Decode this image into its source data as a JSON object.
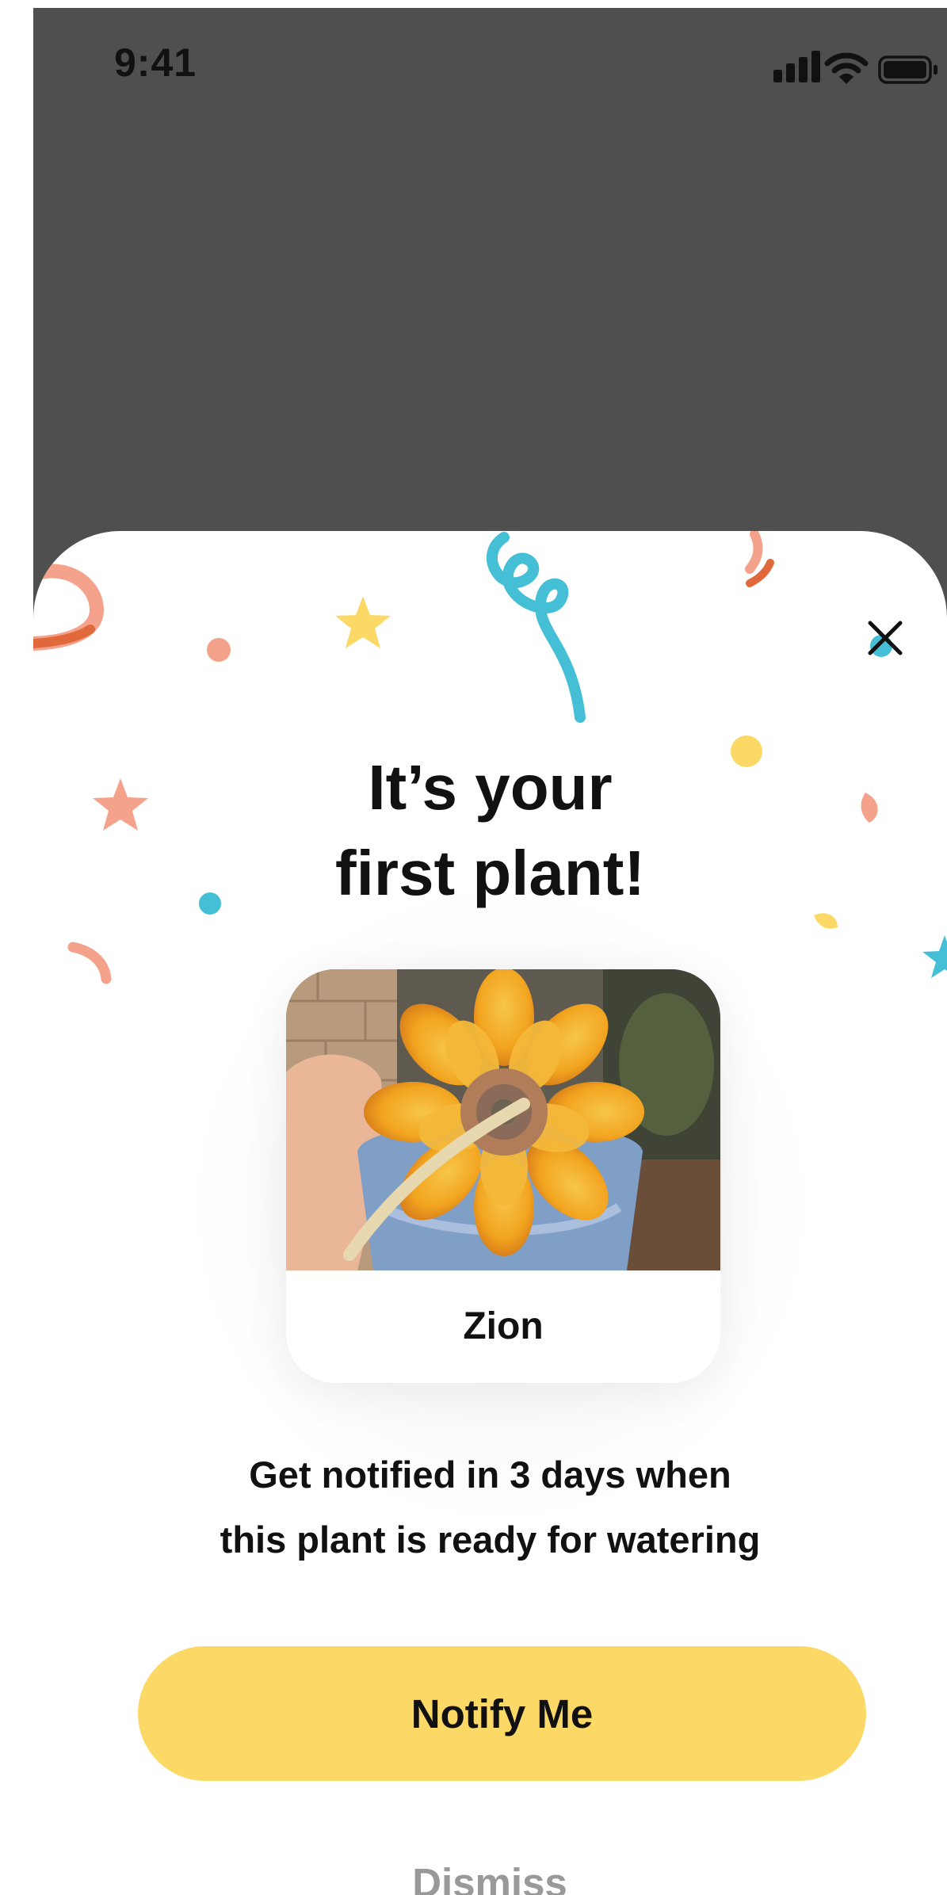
{
  "status_bar": {
    "time": "9:41",
    "icons": [
      "signal-icon",
      "wifi-icon",
      "battery-icon"
    ]
  },
  "sheet": {
    "title_line1": "It’s your",
    "title_line2": "first plant!",
    "plant": {
      "name": "Zion",
      "photo": "succulent-photo"
    },
    "message_line1": "Get notified in 3 days when",
    "message_line2": "this plant is ready for watering",
    "notify_label": "Notify Me",
    "dismiss_label": "Dismiss",
    "close_icon": "close-icon",
    "decoration": "confetti"
  },
  "colors": {
    "backdrop": "#4f4f4f",
    "sheet": "#ffffff",
    "primary_button": "#fcd967",
    "text": "#111111",
    "secondary_text": "#999999",
    "confetti_salmon": "#f4a28c",
    "confetti_orange": "#e0683a",
    "confetti_yellow": "#fcd967",
    "confetti_teal": "#45bfd6"
  }
}
